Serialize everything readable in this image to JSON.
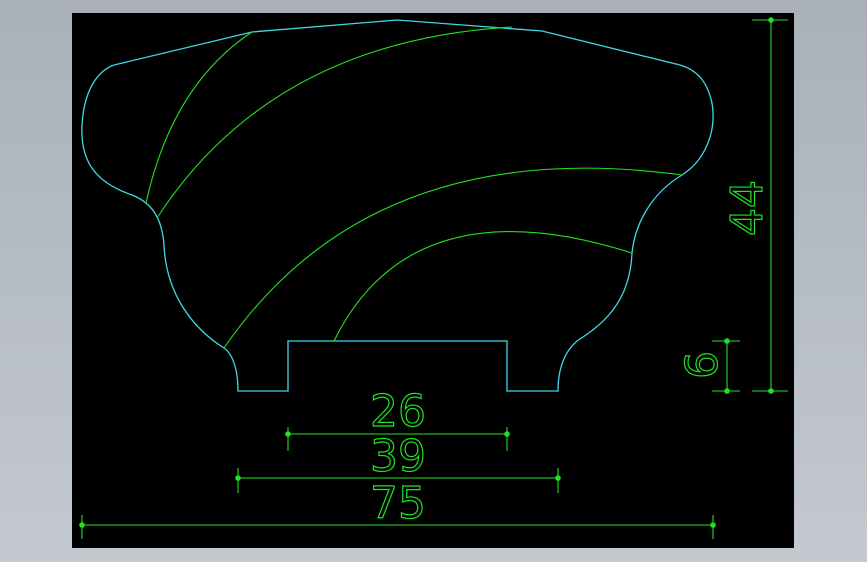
{
  "colors": {
    "background": "#000000",
    "frame": "#b8bec6",
    "outline": "#3fd8e6",
    "dimension": "#22e022"
  },
  "dimensions": {
    "d26": "26",
    "d39": "39",
    "d75": "75",
    "d44": "44",
    "d6": "6"
  }
}
